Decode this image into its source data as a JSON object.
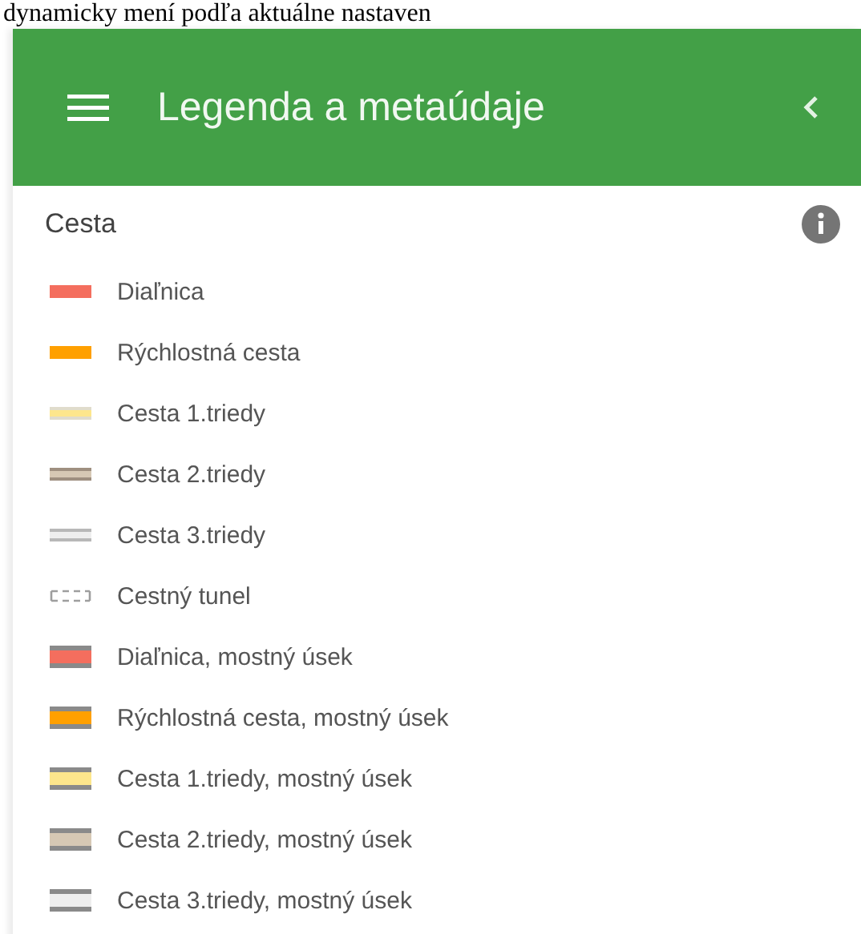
{
  "document_text": "dynamicky mení podľa aktuálne nastaven",
  "header": {
    "title": "Legenda a metaúdaje"
  },
  "section": {
    "title": "Cesta"
  },
  "legend": [
    {
      "kind": "road",
      "color": "#f46e5e",
      "label": "Diaľnica"
    },
    {
      "kind": "road",
      "color": "#ffa000",
      "label": "Rýchlostná cesta"
    },
    {
      "kind": "road",
      "color": "#fde68c",
      "label": "Cesta 1.triedy"
    },
    {
      "kind": "road",
      "color": "#d6c8b4",
      "label": "Cesta 2.triedy"
    },
    {
      "kind": "road",
      "color": "#eeeeee",
      "label": "Cesta 3.triedy"
    },
    {
      "kind": "tunnel",
      "color": "#9e9e9e",
      "label": "Cestný tunel"
    },
    {
      "kind": "bridge",
      "color": "#f46e5e",
      "label": "Diaľnica, mostný úsek"
    },
    {
      "kind": "bridge",
      "color": "#ffa000",
      "label": "Rýchlostná cesta, mostný úsek"
    },
    {
      "kind": "bridge",
      "color": "#fde68c",
      "label": "Cesta 1.triedy, mostný úsek"
    },
    {
      "kind": "bridge",
      "color": "#d6c8b4",
      "label": "Cesta 2.triedy, mostný úsek"
    },
    {
      "kind": "bridge",
      "color": "#eeeeee",
      "label": "Cesta 3.triedy, mostný úsek"
    }
  ]
}
